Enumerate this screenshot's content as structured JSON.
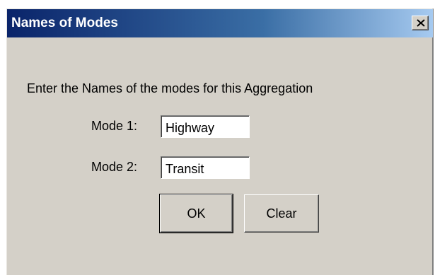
{
  "window": {
    "title": "Names of Modes"
  },
  "dialog": {
    "prompt": "Enter the Names of the modes for this Aggregation",
    "fields": [
      {
        "label": "Mode 1:",
        "value": "Highway"
      },
      {
        "label": "Mode 2:",
        "value": "Transit"
      }
    ],
    "buttons": {
      "ok_label": "OK",
      "clear_label": "Clear"
    }
  },
  "colors": {
    "titlebar_start": "#0a246a",
    "titlebar_end": "#a6caf0",
    "face": "#d4d0c8"
  },
  "icons": {
    "close": "close-icon"
  }
}
